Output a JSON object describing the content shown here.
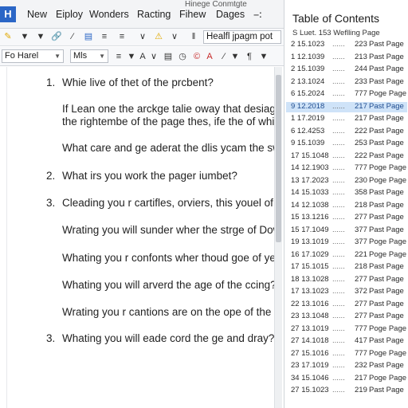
{
  "window": {
    "title": "Hinege Conmtgte"
  },
  "menu": {
    "app_icon": "H",
    "items": [
      "New",
      "Eiploy",
      "Wonders",
      "Racting",
      "Fihew",
      "Dages",
      "−∶"
    ],
    "close": "✖"
  },
  "toolbar1": {
    "icons": [
      "pencil-icon",
      "chevron-down-icon",
      "chevron-down-icon",
      "link-icon",
      "format-icon",
      "align-icon",
      "menu-icon",
      "chevron-down-icon",
      "warning-icon",
      "chevron-down-icon",
      "paragraph-icon",
      "settings-icon"
    ],
    "address_value": "Healfl jpagm pot"
  },
  "toolbar2": {
    "font_value": "Fo Harel",
    "size_value": "Mls",
    "icons": [
      "list-icon",
      "chevron-down-icon",
      "text-color-icon",
      "chevron-down-icon",
      "align-left-icon",
      "clock-icon",
      "copyright-icon",
      "font-color-icon",
      "brush-icon",
      "chevron-down-icon",
      "pilcrow-icon",
      "chevron-down-icon"
    ]
  },
  "document": {
    "lines": [
      {
        "num": "1.",
        "text": "Whie live of thet of the prcbent?"
      },
      {
        "num": "",
        "text": "If Lean one the arckge talie oway that desiage,"
      },
      {
        "num": "",
        "text": "the rightembe of the page thes, ife the of whie"
      },
      {
        "num": "",
        "text": "What care and ge aderat the dlis ycam the swhat"
      },
      {
        "num": "2.",
        "text": "What irs you work the pager iumbet?"
      },
      {
        "num": "3.",
        "text": "Cleading you r cartifles, orviers, this youel of or"
      },
      {
        "num": "",
        "text": "Wrating you will sunder wher the strge of Dow"
      },
      {
        "num": "",
        "text": "Whating you r confonts wher thoud goe of yeur"
      },
      {
        "num": "",
        "text": "Whating you will arverd the age of the ccing?"
      },
      {
        "num": "",
        "text": "Wrating you r cantions are on the ope of the sust"
      },
      {
        "num": "3.",
        "text": "Whating you will eade cord the ge and dray?"
      }
    ]
  },
  "toc": {
    "title": "Table of Contents",
    "subtitle": "S Luet. 153 Weflling Page",
    "rows": [
      {
        "num": "2 15.1023",
        "dots": "......",
        "page": "223",
        "label": "Past Page"
      },
      {
        "num": "1 12.1039",
        "dots": "......",
        "page": "213",
        "label": "Past Page"
      },
      {
        "num": "2 15.1039",
        "dots": "......",
        "page": "244",
        "label": "Past Page"
      },
      {
        "num": "2 13.1024",
        "dots": "......",
        "page": "233",
        "label": "Past Page"
      },
      {
        "num": "6 15.2024",
        "dots": "......",
        "page": "777",
        "label": "Poge Page"
      },
      {
        "num": "9 12.2018",
        "dots": "......",
        "page": "217",
        "label": "Past Page",
        "selected": true
      },
      {
        "num": "1 17.2019",
        "dots": "......",
        "page": "217",
        "label": "Past Page"
      },
      {
        "num": "6 12.4253",
        "dots": "......",
        "page": "222",
        "label": "Past Page"
      },
      {
        "num": "9 15.1039",
        "dots": "......",
        "page": "253",
        "label": "Past Page"
      },
      {
        "num": "17 15.1048",
        "dots": "......",
        "page": "222",
        "label": "Past Page"
      },
      {
        "num": "14 12.1903",
        "dots": "......",
        "page": "777",
        "label": "Poge Page"
      },
      {
        "num": "13 17.2023",
        "dots": "......",
        "page": "230",
        "label": "Poge Page"
      },
      {
        "num": "14 15.1033",
        "dots": "......",
        "page": "358",
        "label": "Past Page"
      },
      {
        "num": "14 12.1038",
        "dots": "......",
        "page": "218",
        "label": "Past Page"
      },
      {
        "num": "15 13.1216",
        "dots": "......",
        "page": "277",
        "label": "Past Page"
      },
      {
        "num": "15 17.1049",
        "dots": "......",
        "page": "377",
        "label": "Past Page"
      },
      {
        "num": "19 13.1019",
        "dots": "......",
        "page": "377",
        "label": "Poge Page"
      },
      {
        "num": "16 17.1029",
        "dots": "......",
        "page": "221",
        "label": "Poge Page"
      },
      {
        "num": "17 15.1015",
        "dots": "......",
        "page": "218",
        "label": "Past Page"
      },
      {
        "num": "18 13.1028",
        "dots": "......",
        "page": "277",
        "label": "Past Page"
      },
      {
        "num": "17 13.1023",
        "dots": "......",
        "page": "372",
        "label": "Past Page"
      },
      {
        "num": "22 13.1016",
        "dots": "......",
        "page": "277",
        "label": "Past Page"
      },
      {
        "num": "23 13.1048",
        "dots": "......",
        "page": "277",
        "label": "Past Page"
      },
      {
        "num": "27 13.1019",
        "dots": "......",
        "page": "777",
        "label": "Poge Page"
      },
      {
        "num": "27 14.1018",
        "dots": "......",
        "page": "417",
        "label": "Past Page"
      },
      {
        "num": "27 15.1016",
        "dots": "......",
        "page": "777",
        "label": "Poge Page"
      },
      {
        "num": "23 17.1019",
        "dots": "......",
        "page": "232",
        "label": "Past Page"
      },
      {
        "num": "34 15.1046",
        "dots": "......",
        "page": "217",
        "label": "Poge Page"
      },
      {
        "num": "27 15.1023",
        "dots": "......",
        "page": "219",
        "label": "Past Page"
      }
    ]
  },
  "colors": {
    "accent": "#2b66c6",
    "selection": "#cfe3f8",
    "toolbar_bg": "#f3f4f6"
  }
}
